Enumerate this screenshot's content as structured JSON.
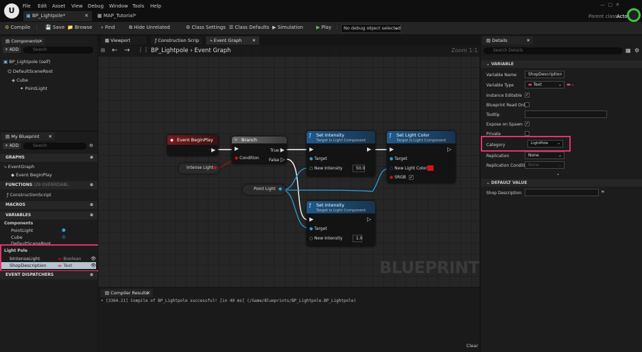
{
  "logo": "U",
  "menu": [
    "File",
    "Edit",
    "Asset",
    "View",
    "Debug",
    "Window",
    "Tools",
    "Help"
  ],
  "tabs": [
    {
      "label": "BP_Lightpole*"
    },
    {
      "label": "MAP_Tutorial*"
    }
  ],
  "parent_class": {
    "label": "Parent class:",
    "value": "Actor"
  },
  "toolbar": {
    "compile": "Compile",
    "save": "Save",
    "browse": "Browse",
    "find": "Find",
    "hide_unrelated": "Hide Unrelated",
    "class_settings": "Class Settings",
    "class_defaults": "Class Defaults",
    "simulation": "Simulation",
    "play": "Play",
    "debug_select": "No debug object selected"
  },
  "components": {
    "title": "Components",
    "add": "+ ADD",
    "search_placeholder": "Search",
    "items": [
      "BP_Lightpole (self)",
      "DefaultSceneRoot",
      "Cube",
      "PointLight"
    ]
  },
  "my_blueprint": {
    "title": "My Blueprint",
    "add": "+ ADD",
    "search_placeholder": "Search",
    "graphs_label": "GRAPHS",
    "event_graph": "EventGraph",
    "event_begin_play": "Event BeginPlay",
    "functions_label": "FUNCTIONS",
    "functions_count": "(29 OVERRIDABL",
    "construction_script": "ConstructionScript",
    "macros_label": "MACROS",
    "variables_label": "VARIABLES",
    "components_cat": "Components",
    "vars": [
      "PointLight",
      "Cube",
      "DefaultSceneRoot"
    ],
    "light_pole_cat": "Light Pole",
    "lp_vars": [
      {
        "name": "bIntenseLight",
        "type": "Boolean"
      },
      {
        "name": "ShopDescription",
        "type": "Text"
      }
    ],
    "event_dispatchers": "EVENT DISPATCHERS"
  },
  "graph_tabs": [
    "Viewport",
    "Construction Scrip",
    "Event Graph"
  ],
  "breadcrumb": {
    "root": "BP_Lightpole",
    "current": "Event Graph"
  },
  "zoom": "Zoom 1:1",
  "watermark": "BLUEPRINT",
  "nodes": {
    "begin_play": "Event BeginPlay",
    "branch": {
      "title": "Branch",
      "condition": "Condition",
      "true": "True",
      "false": "False"
    },
    "intense_light": "Intense Light",
    "point_light": "Point Light",
    "set_intensity_1": {
      "title": "Set Intensity",
      "sub": "Target is Light Component",
      "target": "Target",
      "pin": "New Intensity",
      "value": "50.0"
    },
    "set_light_color": {
      "title": "Set Light Color",
      "sub": "Target is Light Component",
      "target": "Target",
      "pin": "New Light Color",
      "srgb": "SRGB"
    },
    "set_intensity_2": {
      "title": "Set Intensity",
      "sub": "Target is Light Component",
      "target": "Target",
      "pin": "New Intensity",
      "value": "1.0"
    }
  },
  "compiler": {
    "title": "Compiler Results",
    "message": "[3364.21] Compile of BP_Lightpole successful! [in 40 ms] (/Game/Blueprints/BP_Lightpole.BP_Lightpole)",
    "clear": "Clear"
  },
  "details": {
    "title": "Details",
    "search_placeholder": "Search Details",
    "variable_section": "VARIABLE",
    "variable_name_label": "Variable Name",
    "variable_name": "ShopDescription",
    "variable_type_label": "Variable Type",
    "variable_type": "Text",
    "instance_editable": "Instance Editable",
    "bp_read_only": "Blueprint Read Only",
    "tooltip": "Tooltip",
    "expose_spawn": "Expose on Spawn",
    "private": "Private",
    "category_label": "Category",
    "category": "LightPole",
    "replication_label": "Replication",
    "replication": "None",
    "repl_cond_label": "Replication Conditio",
    "repl_cond": "None",
    "default_section": "DEFAULT VALUE",
    "shop_desc_label": "Shop Description"
  }
}
